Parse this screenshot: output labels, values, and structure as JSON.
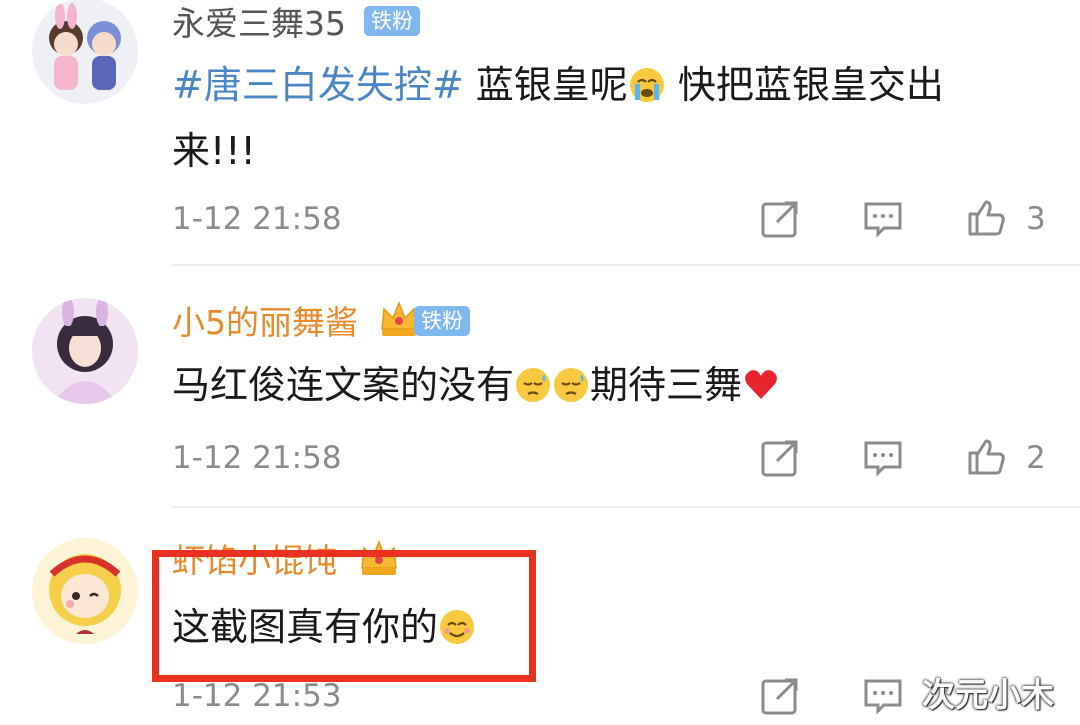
{
  "comments": [
    {
      "username": "永爱三舞35",
      "badge": "铁粉",
      "topic": "#唐三白发失控#",
      "text_before_emoji": " 蓝银皇呢",
      "text_after_emoji": " 快把蓝银皇交出来!!!",
      "emoji": "crying-face-emoji",
      "time": "1-12 21:58",
      "likes": "3"
    },
    {
      "username": "小5的丽舞酱",
      "badge": "铁粉",
      "text_before_emoji": "马红俊连文案的没有",
      "text_after_emoji": "期待三舞",
      "emoji": "sad-sweat-face-emoji",
      "time": "1-12 21:58",
      "likes": "2"
    },
    {
      "username": "虾馅小馄饨",
      "text_before_emoji": "这截图真有你的",
      "emoji": "smiling-face-emoji",
      "time": "1-12 21:53"
    }
  ],
  "watermark": "次元小木",
  "colors": {
    "username_gray": "#555555",
    "username_orange": "#e8892a",
    "topic_blue": "#4a86c6",
    "badge_blue": "#7fb8ee",
    "highlight_red": "#e8321f"
  },
  "icons": [
    "repost-icon",
    "comment-icon",
    "like-icon",
    "crown-icon"
  ]
}
